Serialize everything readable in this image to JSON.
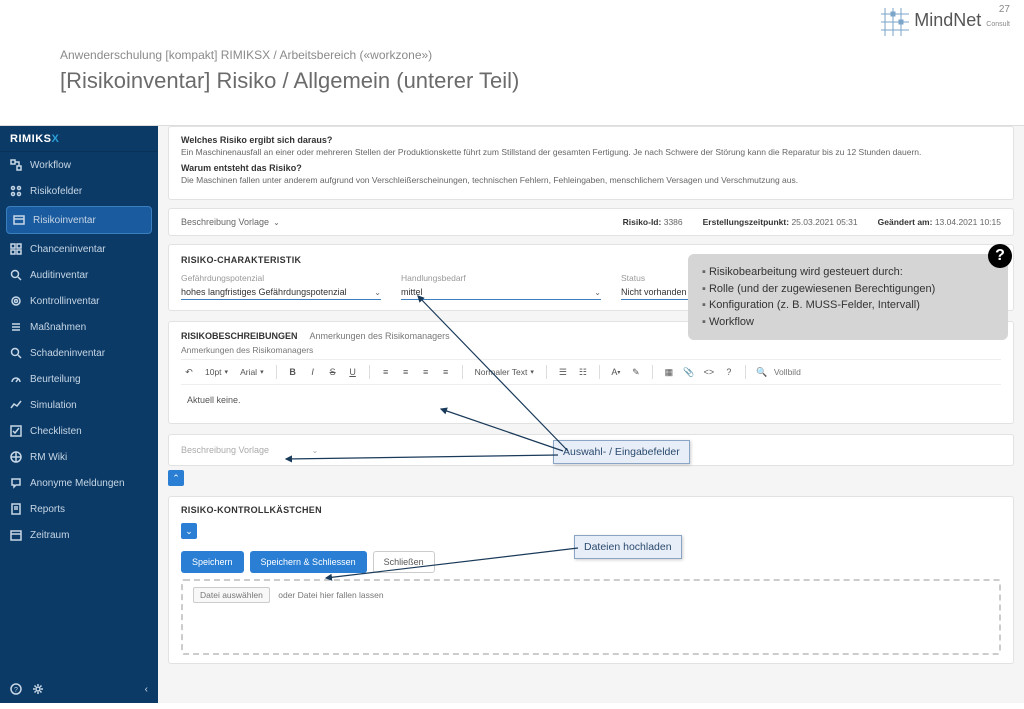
{
  "page_number": "27",
  "brand": {
    "name": "MindNet",
    "suffix": "Consult"
  },
  "slide": {
    "breadcrumb": "Anwenderschulung [kompakt] RIMIKSX / Arbeitsbereich («workzone»)",
    "title": "[Risikoinventar] Risiko / Allgemein (unterer Teil)"
  },
  "sidebar": {
    "logo": {
      "text": "RIMIKS",
      "x": "X"
    },
    "items": [
      {
        "label": "Workflow"
      },
      {
        "label": "Risikofelder"
      },
      {
        "label": "Risikoinventar"
      },
      {
        "label": "Chanceninventar"
      },
      {
        "label": "Auditinventar"
      },
      {
        "label": "Kontrollinventar"
      },
      {
        "label": "Maßnahmen"
      },
      {
        "label": "Schadeninventar"
      },
      {
        "label": "Beurteilung"
      },
      {
        "label": "Simulation"
      },
      {
        "label": "Checklisten"
      },
      {
        "label": "RM Wiki"
      },
      {
        "label": "Anonyme Meldungen"
      },
      {
        "label": "Reports"
      },
      {
        "label": "Zeitraum"
      }
    ]
  },
  "risk_qa": {
    "q1": "Welches Risiko ergibt sich daraus?",
    "a1": "Ein Maschinenausfall an einer oder mehreren Stellen der Produktionskette führt zum Stillstand der gesamten Fertigung. Je nach Schwere der Störung kann die Reparatur bis zu 12 Stunden dauern.",
    "q2": "Warum entsteht das Risiko?",
    "a2": "Die Maschinen fallen unter anderem aufgrund von Verschleißerscheinungen, technischen Fehlern, Fehleingaben, menschlichem Versagen und Verschmutzung aus."
  },
  "meta": {
    "vorlage_label": "Beschreibung Vorlage",
    "id_label": "Risiko-Id:",
    "id_value": "3386",
    "created_label": "Erstellungszeitpunkt:",
    "created_value": "25.03.2021 05:31",
    "changed_label": "Geändert am:",
    "changed_value": "13.04.2021 10:15"
  },
  "charakteristik": {
    "title": "RISIKO-CHARAKTERISTIK",
    "fields": [
      {
        "label": "Gefährdungspotenzial",
        "value": "hohes langfristiges Gefährdungspotenzial"
      },
      {
        "label": "Handlungsbedarf",
        "value": "mittel"
      },
      {
        "label": "Status",
        "value": "Nicht vorhanden"
      }
    ]
  },
  "beschreibungen": {
    "title": "RISIKOBESCHREIBUNGEN",
    "sub": "Anmerkungen des Risikomanagers",
    "sub2": "Anmerkungen des Risikomanagers",
    "toolbar": {
      "fontsize": "10pt",
      "fontfamily": "Arial",
      "format": "Normaler Text",
      "search_ph": "Vollbild"
    },
    "body": "Aktuell keine."
  },
  "vorlage2": "Beschreibung Vorlage",
  "kontroll": {
    "title": "RISIKO-KONTROLLKÄSTCHEN",
    "save": "Speichern",
    "save_close": "Speichern & Schliessen",
    "close": "Schließen",
    "file_picker": "Datei auswählen",
    "file_drop": "oder Datei hier fallen lassen"
  },
  "annotations": {
    "fields": "Auswahl- / Eingabefelder",
    "upload": "Dateien hochladen",
    "help": [
      "Risikobearbeitung wird gesteuert durch:",
      "Rolle (und der zugewiesenen Berechtigungen)",
      "Konfiguration (z. B. MUSS-Felder, Intervall)",
      "Workflow"
    ]
  }
}
